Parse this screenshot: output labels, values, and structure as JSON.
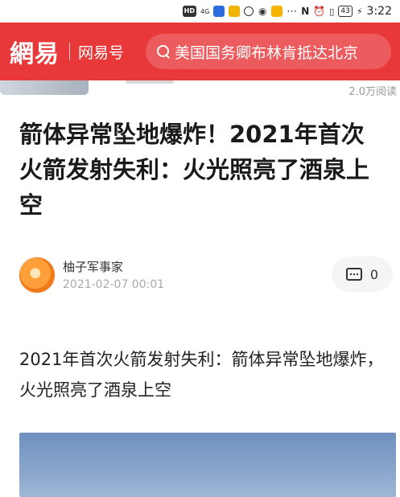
{
  "status_bar": {
    "hd": "HD",
    "signal": "4G",
    "battery": "43",
    "time": "3:22"
  },
  "header": {
    "logo": "網易",
    "subtitle": "网易号",
    "search_text": "美国国务卿布林肯抵达北京"
  },
  "prev_item": {
    "meta": "2.0万阅读"
  },
  "article": {
    "headline": "箭体异常坠地爆炸！2021年首次火箭发射失利：火光照亮了酒泉上空",
    "author": "柚子军事家",
    "date": "2021-02-07 00:01",
    "comment_count": "0",
    "body": "2021年首次火箭发射失利：箭体异常坠地爆炸，火光照亮了酒泉上空"
  },
  "colors": {
    "brand_red": "#e8383a"
  }
}
